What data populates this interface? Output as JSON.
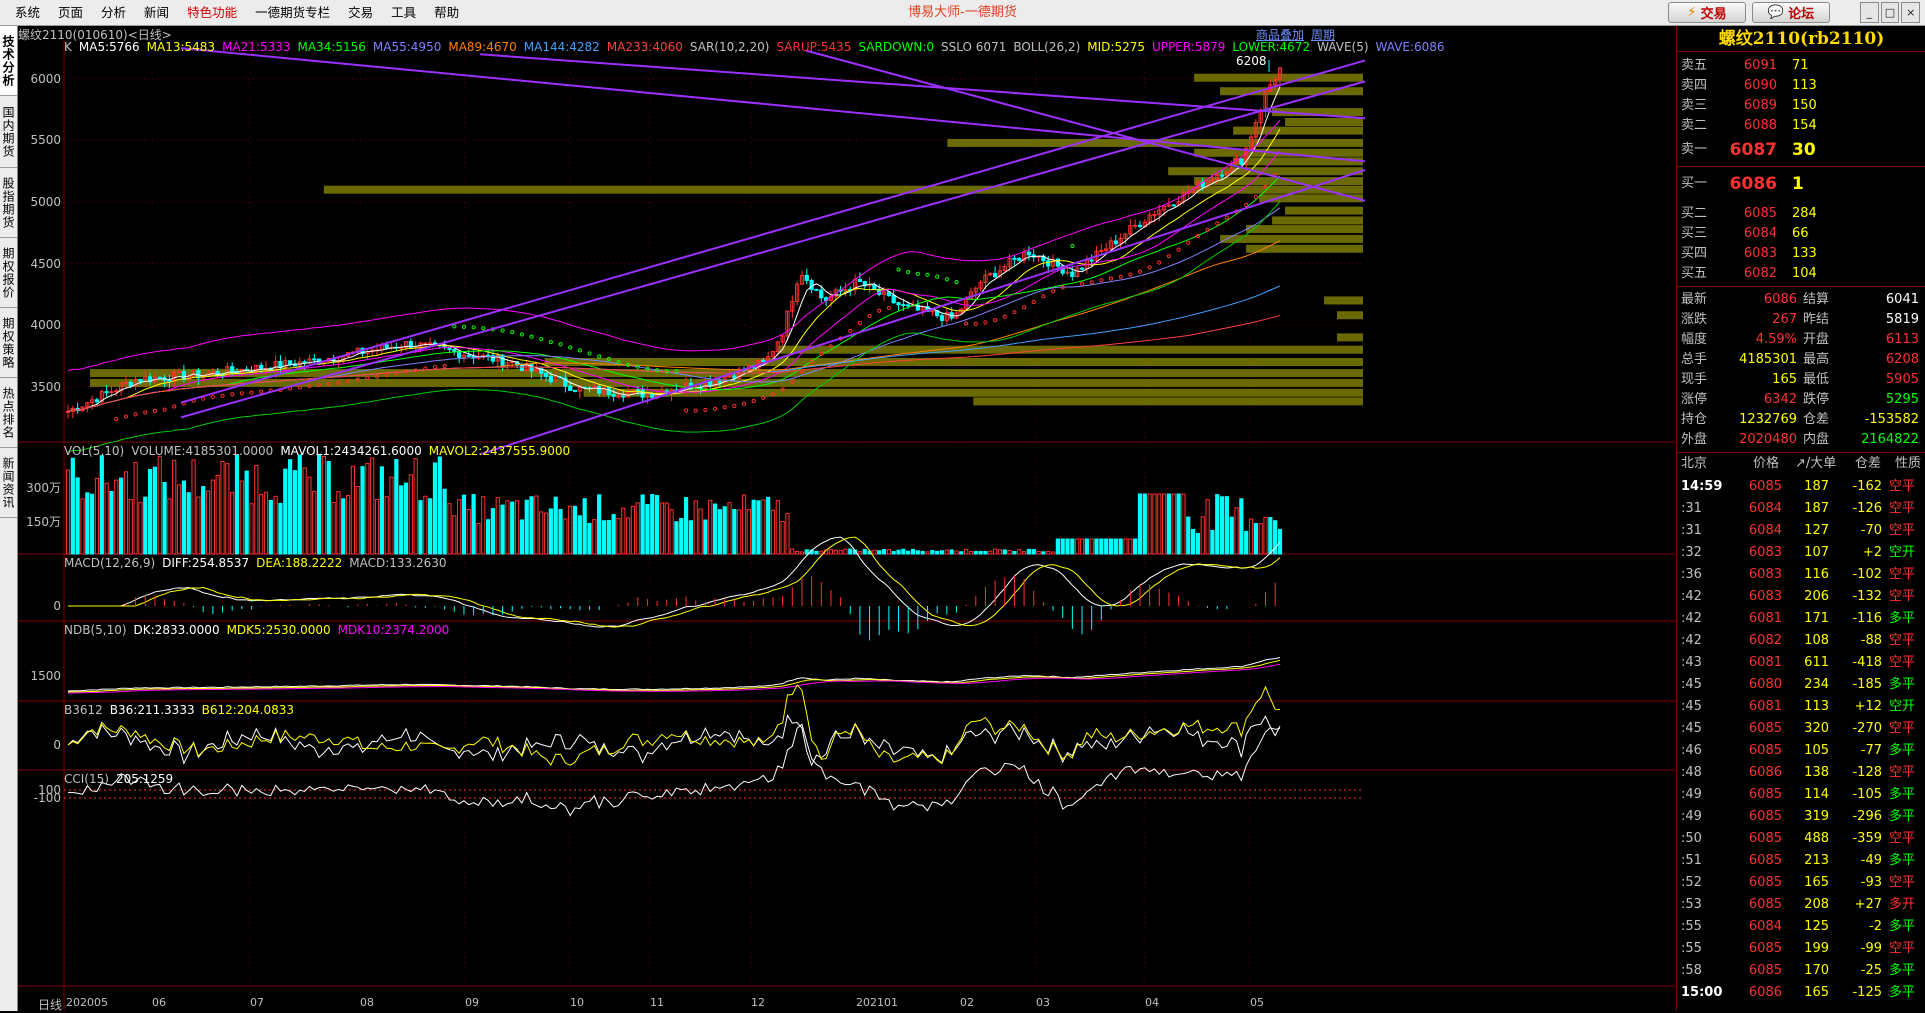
{
  "app_title": "博易大师-一德期货",
  "menu": [
    "系统",
    "页面",
    "分析",
    "新闻",
    "特色功能",
    "一德期货专栏",
    "交易",
    "工具",
    "帮助"
  ],
  "menu_highlight_index": 4,
  "buttons": {
    "trade": "交易",
    "forum": "论坛"
  },
  "side_tabs": [
    "技术分析",
    "国内期货",
    "股指期货",
    "期权报价",
    "期权策略",
    "热点排名",
    "新闻资讯"
  ],
  "chart_header": {
    "symbol": "螺纹2110(010610)<日线>",
    "link_overlay": "商品叠加",
    "link_period": "周期"
  },
  "main_indicators": [
    {
      "text": "K",
      "color": "#c0c0c0"
    },
    {
      "text": "MA5:5766",
      "color": "#ffffff"
    },
    {
      "text": "MA13:5483",
      "color": "#ffff00"
    },
    {
      "text": "MA21:5333",
      "color": "#ff00ff"
    },
    {
      "text": "MA34:5156",
      "color": "#00ff00"
    },
    {
      "text": "MA55:4950",
      "color": "#8080ff"
    },
    {
      "text": "MA89:4670",
      "color": "#ff8000"
    },
    {
      "text": "MA144:4282",
      "color": "#40a0ff"
    },
    {
      "text": "MA233:4060",
      "color": "#ff4040"
    },
    {
      "text": "SAR(10,2,20)",
      "color": "#c0c0c0"
    },
    {
      "text": "SARUP:5435",
      "color": "#ff3030"
    },
    {
      "text": "SARDOWN:0",
      "color": "#00ff00"
    },
    {
      "text": "SSLO 6071",
      "color": "#c0c0c0"
    },
    {
      "text": "BOLL(26,2)",
      "color": "#c0c0c0"
    },
    {
      "text": "MID:5275",
      "color": "#ffff00"
    },
    {
      "text": "UPPER:5879",
      "color": "#ff00ff"
    },
    {
      "text": "LOWER:4672",
      "color": "#00ff00"
    },
    {
      "text": "WAVE(5)",
      "color": "#c0c0c0"
    },
    {
      "text": "WAVE:6086",
      "color": "#8080ff"
    }
  ],
  "main_y_ticks": [
    "6000",
    "5500",
    "5000",
    "4500",
    "4000",
    "3500"
  ],
  "peak_label": "6208",
  "vol_indicators": [
    {
      "text": "VOL(5,10)",
      "color": "#c0c0c0"
    },
    {
      "text": "VOLUME:4185301.0000",
      "color": "#c0c0c0"
    },
    {
      "text": "MAVOL1:2434261.6000",
      "color": "#ffffff"
    },
    {
      "text": "MAVOL2:2437555.9000",
      "color": "#ffff00"
    }
  ],
  "vol_y_ticks": [
    "300万",
    "150万"
  ],
  "macd_indicators": [
    {
      "text": "MACD(12,26,9)",
      "color": "#c0c0c0"
    },
    {
      "text": "DIFF:254.8537",
      "color": "#ffffff"
    },
    {
      "text": "DEA:188.2222",
      "color": "#ffff00"
    },
    {
      "text": "MACD:133.2630",
      "color": "#c0c0c0"
    }
  ],
  "macd_y_ticks": [
    "0"
  ],
  "ndb_indicators": [
    {
      "text": "NDB(5,10)",
      "color": "#c0c0c0"
    },
    {
      "text": "DK:2833.0000",
      "color": "#ffffff"
    },
    {
      "text": "MDK5:2530.0000",
      "color": "#ffff00"
    },
    {
      "text": "MDK10:2374.2000",
      "color": "#ff00ff"
    }
  ],
  "ndb_y_ticks": [
    "1500"
  ],
  "b36_indicators": [
    {
      "text": "B3612",
      "color": "#c0c0c0"
    },
    {
      "text": "B36:211.3333",
      "color": "#ffffff"
    },
    {
      "text": "B612:204.0833",
      "color": "#ffff00"
    }
  ],
  "b36_y_ticks": [
    "0"
  ],
  "cci_indicators": [
    {
      "text": "CCI(15)",
      "color": "#c0c0c0"
    },
    {
      "text": "205.1259",
      "color": "#ffffff"
    }
  ],
  "cci_y_ticks": [
    "100",
    "-100"
  ],
  "x_axis_label": "日线",
  "x_ticks": [
    "202005",
    "06",
    "07",
    "08",
    "09",
    "10",
    "11",
    "12",
    "202101",
    "02",
    "03",
    "04",
    "05"
  ],
  "quote": {
    "title": "螺纹2110(rb2110)",
    "asks": [
      {
        "label": "卖五",
        "price": "6091",
        "vol": "71"
      },
      {
        "label": "卖四",
        "price": "6090",
        "vol": "113"
      },
      {
        "label": "卖三",
        "price": "6089",
        "vol": "150"
      },
      {
        "label": "卖二",
        "price": "6088",
        "vol": "154"
      }
    ],
    "ask1": {
      "label": "卖一",
      "price": "6087",
      "vol": "30"
    },
    "bid1": {
      "label": "买一",
      "price": "6086",
      "vol": "1"
    },
    "bids": [
      {
        "label": "买二",
        "price": "6085",
        "vol": "284"
      },
      {
        "label": "买三",
        "price": "6084",
        "vol": "66"
      },
      {
        "label": "买四",
        "price": "6083",
        "vol": "133"
      },
      {
        "label": "买五",
        "price": "6082",
        "vol": "104"
      }
    ],
    "stats": [
      {
        "l1": "最新",
        "v1": "6086",
        "c1": "#ff3030",
        "l2": "结算",
        "v2": "6041",
        "c2": "#ffffff"
      },
      {
        "l1": "涨跌",
        "v1": "267",
        "c1": "#ff3030",
        "l2": "昨结",
        "v2": "5819",
        "c2": "#ffffff"
      },
      {
        "l1": "幅度",
        "v1": "4.59%",
        "c1": "#ff3030",
        "l2": "开盘",
        "v2": "6113",
        "c2": "#ff3030"
      },
      {
        "l1": "总手",
        "v1": "4185301",
        "c1": "#ffff00",
        "l2": "最高",
        "v2": "6208",
        "c2": "#ff3030"
      },
      {
        "l1": "现手",
        "v1": "165",
        "c1": "#ffff00",
        "l2": "最低",
        "v2": "5905",
        "c2": "#ff3030"
      },
      {
        "l1": "涨停",
        "v1": "6342",
        "c1": "#ff3030",
        "l2": "跌停",
        "v2": "5295",
        "c2": "#00ff00"
      },
      {
        "l1": "持仓",
        "v1": "1232769",
        "c1": "#ffff00",
        "l2": "仓差",
        "v2": "-153582",
        "c2": "#ffff00"
      },
      {
        "l1": "外盘",
        "v1": "2020480",
        "c1": "#ff3030",
        "l2": "内盘",
        "v2": "2164822",
        "c2": "#00ff00"
      }
    ],
    "tick_headers": [
      "北京",
      "价格",
      "↗/大单",
      "仓差",
      "性质"
    ],
    "ticks": [
      {
        "t": "14:59",
        "p": "6085",
        "v": "187",
        "d": "-162",
        "n": "空平",
        "nc": "#ff3030"
      },
      {
        "t": ":31",
        "p": "6084",
        "v": "187",
        "d": "-126",
        "n": "空平",
        "nc": "#ff3030"
      },
      {
        "t": ":31",
        "p": "6084",
        "v": "127",
        "d": "-70",
        "n": "空平",
        "nc": "#ff3030"
      },
      {
        "t": ":32",
        "p": "6083",
        "v": "107",
        "d": "+2",
        "n": "空开",
        "nc": "#00ff00"
      },
      {
        "t": ":36",
        "p": "6083",
        "v": "116",
        "d": "-102",
        "n": "空平",
        "nc": "#ff3030"
      },
      {
        "t": ":42",
        "p": "6083",
        "v": "206",
        "d": "-132",
        "n": "空平",
        "nc": "#ff3030"
      },
      {
        "t": ":42",
        "p": "6081",
        "v": "171",
        "d": "-116",
        "n": "多平",
        "nc": "#00ff00"
      },
      {
        "t": ":42",
        "p": "6082",
        "v": "108",
        "d": "-88",
        "n": "空平",
        "nc": "#ff3030"
      },
      {
        "t": ":43",
        "p": "6081",
        "v": "611",
        "d": "-418",
        "n": "空平",
        "nc": "#ff3030"
      },
      {
        "t": ":45",
        "p": "6080",
        "v": "234",
        "d": "-185",
        "n": "多平",
        "nc": "#00ff00"
      },
      {
        "t": ":45",
        "p": "6081",
        "v": "113",
        "d": "+12",
        "n": "空开",
        "nc": "#00ff00"
      },
      {
        "t": ":45",
        "p": "6085",
        "v": "320",
        "d": "-270",
        "n": "空平",
        "nc": "#ff3030"
      },
      {
        "t": ":46",
        "p": "6085",
        "v": "105",
        "d": "-77",
        "n": "多平",
        "nc": "#00ff00"
      },
      {
        "t": ":48",
        "p": "6086",
        "v": "138",
        "d": "-128",
        "n": "空平",
        "nc": "#ff3030"
      },
      {
        "t": ":49",
        "p": "6085",
        "v": "114",
        "d": "-105",
        "n": "多平",
        "nc": "#00ff00"
      },
      {
        "t": ":49",
        "p": "6085",
        "v": "319",
        "d": "-296",
        "n": "多平",
        "nc": "#00ff00"
      },
      {
        "t": ":50",
        "p": "6085",
        "v": "488",
        "d": "-359",
        "n": "空平",
        "nc": "#ff3030"
      },
      {
        "t": ":51",
        "p": "6085",
        "v": "213",
        "d": "-49",
        "n": "多平",
        "nc": "#00ff00"
      },
      {
        "t": ":52",
        "p": "6085",
        "v": "165",
        "d": "-93",
        "n": "空平",
        "nc": "#ff3030"
      },
      {
        "t": ":53",
        "p": "6085",
        "v": "208",
        "d": "+27",
        "n": "多开",
        "nc": "#ff3030"
      },
      {
        "t": ":55",
        "p": "6084",
        "v": "125",
        "d": "-2",
        "n": "多平",
        "nc": "#00ff00"
      },
      {
        "t": ":55",
        "p": "6085",
        "v": "199",
        "d": "-99",
        "n": "空平",
        "nc": "#ff3030"
      },
      {
        "t": ":58",
        "p": "6085",
        "v": "170",
        "d": "-25",
        "n": "多平",
        "nc": "#00ff00"
      },
      {
        "t": "15:00",
        "p": "6086",
        "v": "165",
        "d": "-125",
        "n": "多平",
        "nc": "#00ff00"
      }
    ]
  },
  "colors": {
    "up": "#ff3030",
    "down": "#00ffff",
    "grid": "#800000",
    "trend": "#9b30ff",
    "vprofile": "#707000"
  },
  "chart_data": {
    "type": "candlestick",
    "price_range": [
      3050,
      6300
    ],
    "trend_lines": [
      {
        "from": [
          "202005",
          6250
        ],
        "to": [
          "05",
          5330
        ]
      },
      {
        "from": [
          "202008",
          6200
        ],
        "to": [
          "05",
          5680
        ]
      },
      {
        "from": [
          "202005",
          3370
        ],
        "to": [
          "05",
          6150
        ]
      },
      {
        "from": [
          "202008",
          2950
        ],
        "to": [
          "05",
          5260
        ]
      },
      {
        "from": [
          "202005",
          3250
        ],
        "to": [
          "05",
          5980
        ]
      },
      {
        "from": [
          "202012",
          6230
        ],
        "to": [
          "05",
          5010
        ]
      }
    ],
    "volume_profile": [
      {
        "price": 6010,
        "len": 0.13
      },
      {
        "price": 5900,
        "len": 0.11
      },
      {
        "price": 5730,
        "len": 0.07
      },
      {
        "price": 5650,
        "len": 0.06
      },
      {
        "price": 5580,
        "len": 0.1
      },
      {
        "price": 5480,
        "len": 0.32
      },
      {
        "price": 5400,
        "len": 0.13
      },
      {
        "price": 5330,
        "len": 0.1
      },
      {
        "price": 5250,
        "len": 0.15
      },
      {
        "price": 5170,
        "len": 0.13
      },
      {
        "price": 5100,
        "len": 0.8
      },
      {
        "price": 5030,
        "len": 0.08
      },
      {
        "price": 4930,
        "len": 0.06
      },
      {
        "price": 4850,
        "len": 0.07
      },
      {
        "price": 4780,
        "len": 0.09
      },
      {
        "price": 4700,
        "len": 0.11
      },
      {
        "price": 4620,
        "len": 0.09
      },
      {
        "price": 4200,
        "len": 0.03
      },
      {
        "price": 4080,
        "len": 0.02
      },
      {
        "price": 3900,
        "len": 0.02
      },
      {
        "price": 3800,
        "len": 0.45
      },
      {
        "price": 3700,
        "len": 0.63
      },
      {
        "price": 3610,
        "len": 0.98
      },
      {
        "price": 3530,
        "len": 0.98
      },
      {
        "price": 3450,
        "len": 0.6
      },
      {
        "price": 3380,
        "len": 0.3
      }
    ]
  }
}
